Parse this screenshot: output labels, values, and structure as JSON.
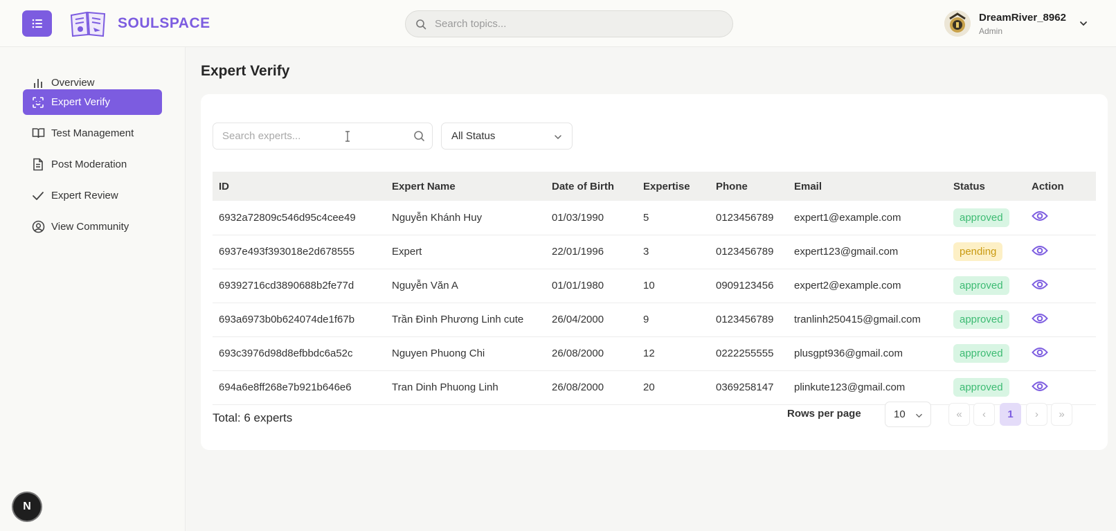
{
  "header": {
    "brand": "SOULSPACE",
    "search_placeholder": "Search topics...",
    "user": {
      "name": "DreamRiver_8962",
      "role": "Admin"
    }
  },
  "sidebar": {
    "items": [
      {
        "label": "Overview",
        "icon": "bar-chart-icon",
        "active": false
      },
      {
        "label": "Expert Verify",
        "icon": "scan-face-icon",
        "active": true
      },
      {
        "label": "Test Management",
        "icon": "book-open-icon",
        "active": false
      },
      {
        "label": "Post Moderation",
        "icon": "file-text-icon",
        "active": false
      },
      {
        "label": "Expert Review",
        "icon": "check-icon",
        "active": false
      },
      {
        "label": "View Community",
        "icon": "user-circle-icon",
        "active": false
      }
    ],
    "badge": "N"
  },
  "main": {
    "title": "Expert Verify",
    "search_placeholder": "Search experts...",
    "status_filter": "All Status",
    "columns": [
      "ID",
      "Expert Name",
      "Date of Birth",
      "Expertise",
      "Phone",
      "Email",
      "Status",
      "Action"
    ],
    "rows": [
      {
        "id": "6932a72809c546d95c4cee49",
        "name": "Nguyễn Khánh Huy",
        "dob": "01/03/1990",
        "expertise": "5",
        "phone": "0123456789",
        "email": "expert1@example.com",
        "status": "approved"
      },
      {
        "id": "6937e493f393018e2d678555",
        "name": "Expert",
        "dob": "22/01/1996",
        "expertise": "3",
        "phone": "0123456789",
        "email": "expert123@gmail.com",
        "status": "pending"
      },
      {
        "id": "69392716cd3890688b2fe77d",
        "name": "Nguyễn Văn A",
        "dob": "01/01/1980",
        "expertise": "10",
        "phone": "0909123456",
        "email": "expert2@example.com",
        "status": "approved"
      },
      {
        "id": "693a6973b0b624074de1f67b",
        "name": "Trần Đình Phương Linh cute",
        "dob": "26/04/2000",
        "expertise": "9",
        "phone": "0123456789",
        "email": "tranlinh250415@gmail.com",
        "status": "approved"
      },
      {
        "id": "693c3976d98d8efbbdc6a52c",
        "name": "Nguyen Phuong Chi",
        "dob": "26/08/2000",
        "expertise": "12",
        "phone": "0222255555",
        "email": "plusgpt936@gmail.com",
        "status": "approved"
      },
      {
        "id": "694a6e8ff268e7b921b646e6",
        "name": "Tran Dinh Phuong Linh",
        "dob": "26/08/2000",
        "expertise": "20",
        "phone": "0369258147",
        "email": "plinkute123@gmail.com",
        "status": "approved"
      }
    ],
    "total": "Total: 6 experts",
    "rows_per_page_label": "Rows per page",
    "rows_per_page": "10",
    "pagination": {
      "first": "«",
      "prev": "‹",
      "current": "1",
      "next": "›",
      "last": "»"
    }
  },
  "colors": {
    "accent": "#7c5ce0",
    "approved_bg": "#d8f5e3",
    "approved_text": "#3dbb73",
    "pending_bg": "#fdf0c6",
    "pending_text": "#c99a12"
  }
}
